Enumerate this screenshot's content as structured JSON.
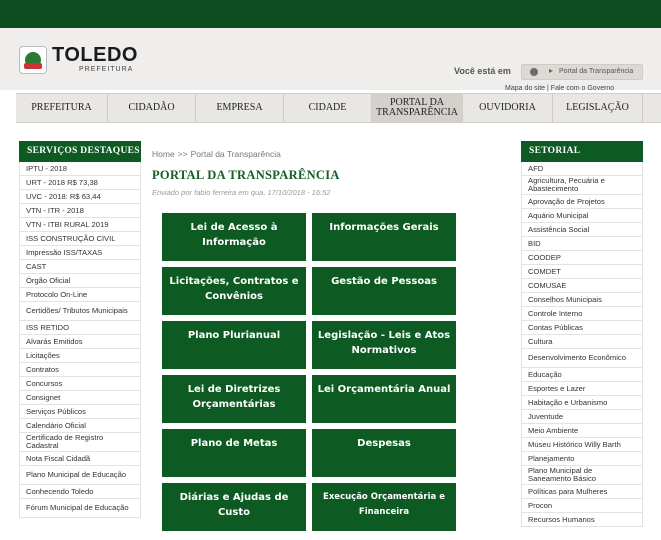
{
  "header": {
    "brand_name": "TOLEDO",
    "brand_sub": "PREFEITURA",
    "voce_esta_em": "Você está em",
    "current_location": "Portal da Transparência",
    "top_links": "Mapa do site | Fale com o Governo"
  },
  "nav": {
    "items": [
      {
        "label": "PREFEITURA"
      },
      {
        "label": "CIDADÃO"
      },
      {
        "label": "EMPRESA"
      },
      {
        "label": "CIDADE"
      },
      {
        "label": "PORTAL DA TRANSPARÊNCIA"
      },
      {
        "label": "OUVIDORIA"
      },
      {
        "label": "LEGISLAÇÃO"
      }
    ]
  },
  "left_sidebar": {
    "title": "SERVIÇOS DESTAQUES",
    "items": [
      "IPTU - 2018",
      "URT - 2018 R$ 73,38",
      "UVC - 2018: R$ 63,44",
      "VTN - ITR - 2018",
      "VTN - ITBI RURAL 2019",
      "ISS CONSTRUÇÃO CIVIL",
      "Impressão ISS/TAXAS",
      "CAST",
      "Órgão Oficial",
      "Protocolo On-Line",
      "Certidões/ Tributos Municipais",
      "ISS RETIDO",
      "Alvarás Emitidos",
      "Licitações",
      "Contratos",
      "Concursos",
      "Consignet",
      "Serviços Públicos",
      "Calendário Oficial",
      "Certificado de Registro Cadastral",
      "Nota Fiscal Cidadã",
      "Plano Municipal de Educação",
      "Conhecendo Toledo",
      "Fórum Municipal de Educação"
    ]
  },
  "right_sidebar": {
    "title": "SETORIAL",
    "items": [
      "AFD",
      "Agricultura, Pecuária e Abastecimento",
      "Aprovação de Projetos",
      "Aquário Municipal",
      "Assistência Social",
      "BID",
      "COODEP",
      "COMDET",
      "COMUSAE",
      "Conselhos Municipais",
      "Controle Interno",
      "Contas Públicas",
      "Cultura",
      "Desenvolvimento Econômico",
      "Educação",
      "Esportes e Lazer",
      "Habitação e Urbanismo",
      "Juventude",
      "Meio Ambiente",
      "Museu Histórico Willy Barth",
      "Planejamento",
      "Plano Municipal de Saneamento Básico",
      "Políticas para Mulheres",
      "Procon",
      "Recursos Humanos"
    ]
  },
  "main": {
    "breadcrumb_home": "Home",
    "breadcrumb_sep": ">>",
    "breadcrumb_current": "Portal da Transparência",
    "title": "PORTAL DA TRANSPARÊNCIA",
    "meta": "Enviado por fabio ferreira em qua, 17/10/2018 - 16:52",
    "tiles": [
      "Lei de Acesso à Informação",
      "Informações Gerais",
      "Licitações, Contratos e Convênios",
      "Gestão de Pessoas",
      "Plano Plurianual",
      "Legislação - Leis e Atos Normativos",
      "Lei de Diretrizes Orçamentárias",
      "Lei Orçamentária Anual",
      "Plano de Metas",
      "Despesas",
      "Diárias e Ajudas de Custo",
      "Execução Orçamentária e Financeira"
    ]
  },
  "colors": {
    "brand_green": "#0e5a23",
    "topbar_green": "#0e4d1f",
    "title_green": "#155f26"
  }
}
